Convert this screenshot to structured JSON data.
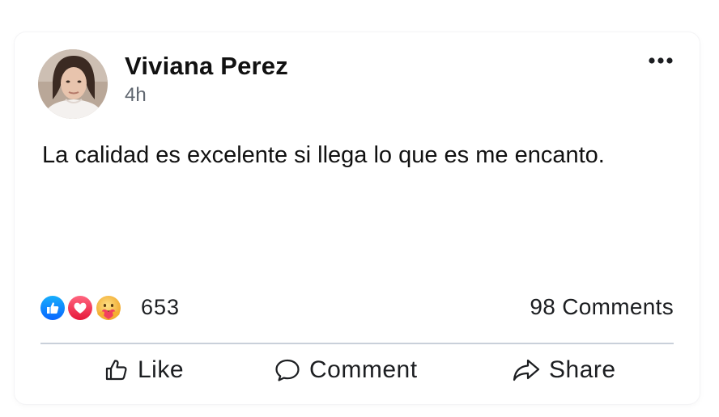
{
  "post": {
    "author": "Viviana Perez",
    "time": "4h",
    "text": "La calidad es excelente si llega lo que es me encanto."
  },
  "reactions": {
    "icons": [
      "like-icon",
      "love-icon",
      "care-icon"
    ],
    "count": "653"
  },
  "comments": {
    "count_label": "98 Comments"
  },
  "actions": {
    "like_label": "Like",
    "comment_label": "Comment",
    "share_label": "Share"
  },
  "colors": {
    "like_blue": "#1877f2",
    "love_red": "#f33e58",
    "care_yellow": "#f7b125",
    "divider": "#c9d0da",
    "secondary_text": "#606770"
  }
}
